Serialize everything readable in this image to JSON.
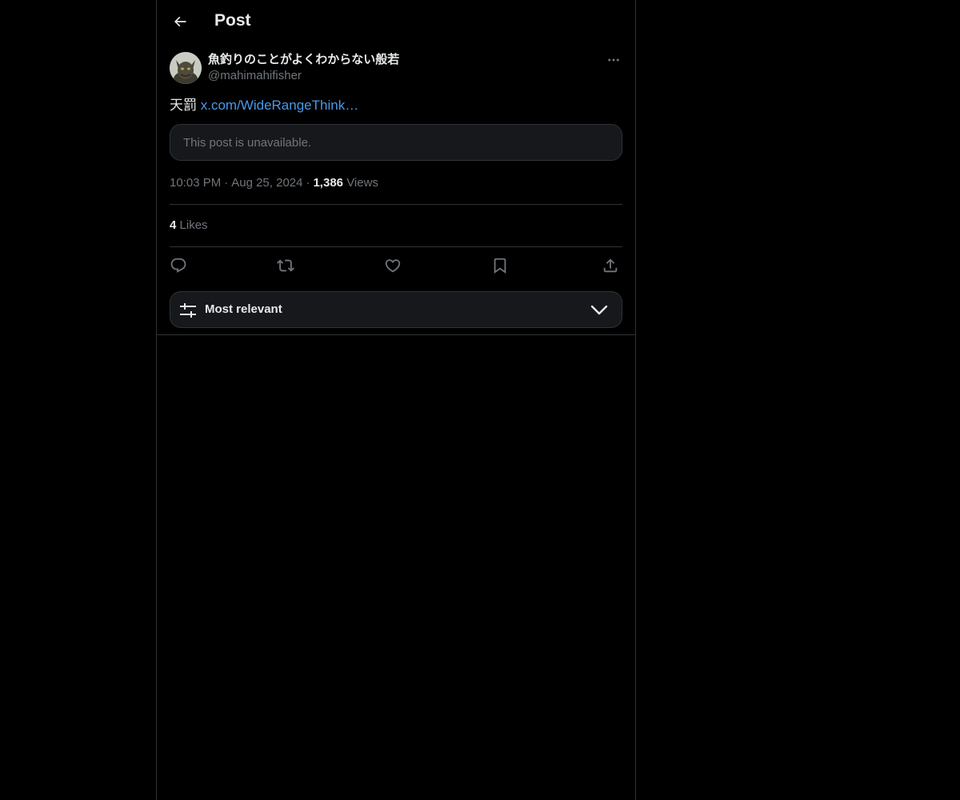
{
  "header": {
    "title": "Post",
    "back_icon": "arrow-left-icon"
  },
  "post": {
    "author": {
      "display_name": "魚釣りのことがよくわからない般若",
      "handle": "@mahimahifisher",
      "avatar": "avatar-image"
    },
    "more_icon": "more-horizontal-icon",
    "text": "天罰",
    "link_text": "x.com/WideRangeThink…",
    "quoted_notice": "This post is unavailable.",
    "time": "10:03 PM",
    "date": "Aug 25, 2024",
    "separator": "·",
    "views_count": "1,386",
    "views_label": "Views",
    "likes_count": "4",
    "likes_label": "Likes"
  },
  "actions": [
    {
      "name": "reply-icon"
    },
    {
      "name": "repost-icon"
    },
    {
      "name": "like-icon"
    },
    {
      "name": "bookmark-icon"
    },
    {
      "name": "share-icon"
    }
  ],
  "sort": {
    "label": "Most relevant",
    "icon": "sliders-icon",
    "chevron": "chevron-down-icon"
  },
  "colors": {
    "background": "#000000",
    "text": "#e7e9ea",
    "muted": "#71767b",
    "link": "#4a99e9",
    "border": "#2f3336",
    "card": "#16181c"
  }
}
